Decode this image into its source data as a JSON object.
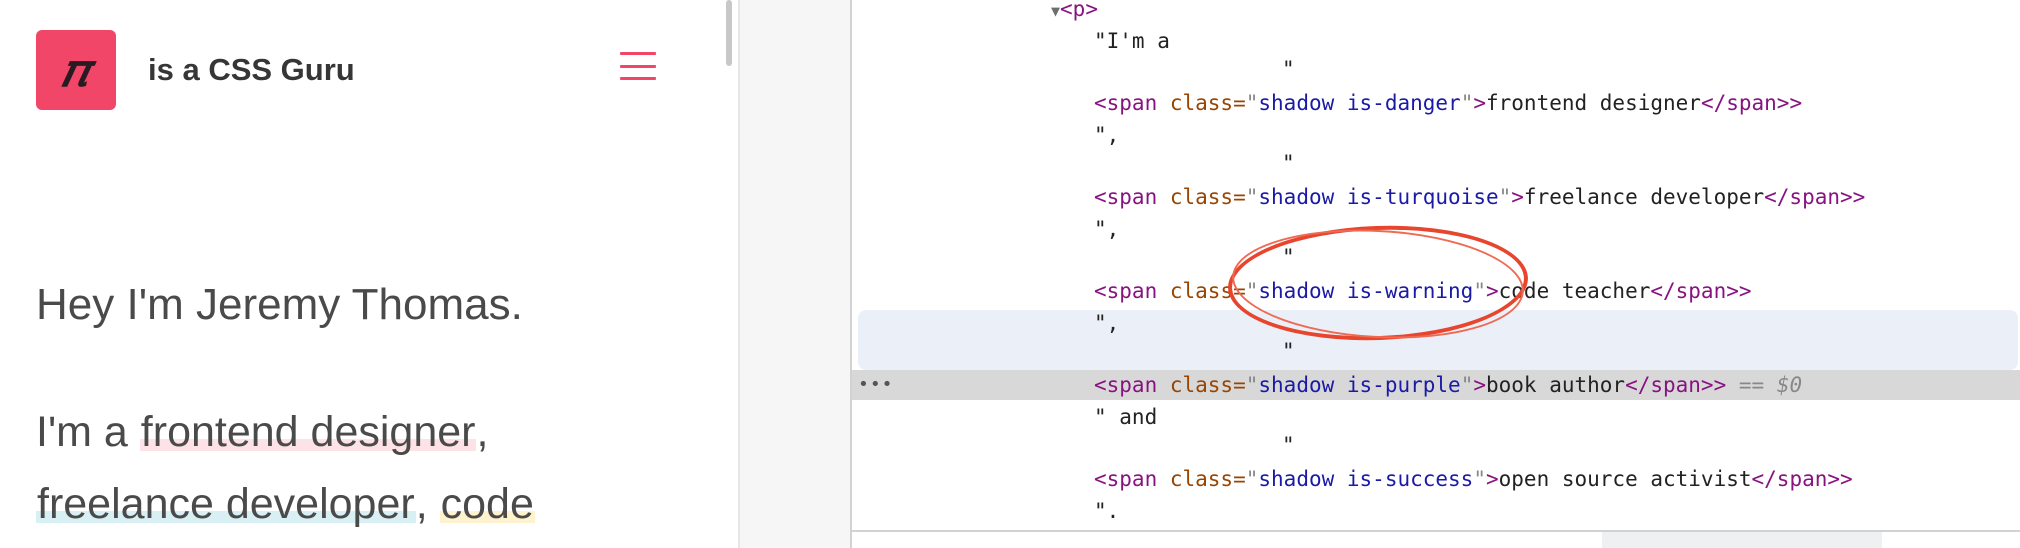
{
  "site": {
    "logo_glyph": "𝜋",
    "brand_text": "is a CSS Guru",
    "menu_icon": "hamburger-icon",
    "hero_line": "Hey I'm Jeremy Thomas.",
    "intro": {
      "lead": "I'm a ",
      "role_1": "frontend designer",
      "sep_1": ", ",
      "role_2": "freelance developer",
      "sep_2": ", ",
      "role_3": "code"
    },
    "accent_color": "#f14668"
  },
  "devtools": {
    "nodes": [
      {
        "kind": "open",
        "tag": "p"
      },
      {
        "kind": "text",
        "text": "\"I'm a"
      },
      {
        "kind": "text",
        "text": "\""
      },
      {
        "kind": "span",
        "class_value": "shadow is-danger",
        "content": "frontend designer"
      },
      {
        "kind": "text",
        "text": "\","
      },
      {
        "kind": "text",
        "text": "\""
      },
      {
        "kind": "span",
        "class_value": "shadow is-turquoise",
        "content": "freelance developer"
      },
      {
        "kind": "text",
        "text": "\","
      },
      {
        "kind": "text",
        "text": "\""
      },
      {
        "kind": "span",
        "class_value": "shadow is-warning",
        "content": "code teacher"
      },
      {
        "kind": "text",
        "text": "\","
      },
      {
        "kind": "text",
        "text": "\""
      },
      {
        "kind": "span",
        "class_value": "shadow is-purple",
        "content": "book author",
        "suffix": " == $0"
      },
      {
        "kind": "text",
        "text": "\" and"
      },
      {
        "kind": "text",
        "text": "\""
      },
      {
        "kind": "span",
        "class_value": "shadow is-success",
        "content": "open source activist"
      },
      {
        "kind": "text",
        "text": "\"."
      }
    ],
    "tokens": {
      "span_open": "<span",
      "class_attr": " class=",
      "quote": "\"",
      "gt": ">",
      "span_close": "</span>",
      "p_open": "<p>",
      "expand_arrow": "▼",
      "ellipsis": "•••"
    },
    "highlighted_class": "shadow is-warning",
    "annotation_color": "#e8452e"
  }
}
